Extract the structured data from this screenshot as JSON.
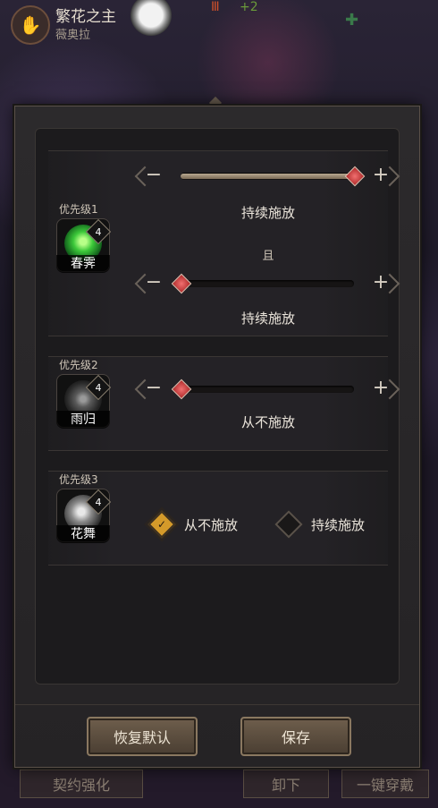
{
  "hud": {
    "title": "繁花之主",
    "subtitle": "薇奥拉",
    "counter": "+2"
  },
  "bottom_bar": {
    "contract": "契约强化",
    "unequip": "卸下",
    "equip_all": "一键穿戴"
  },
  "dialog": {
    "rows": [
      {
        "priority": "优先级1",
        "skill_name": "春霁",
        "level": "4",
        "icon": "green-flame-icon",
        "slider1_value": 1.0,
        "condition1": "持续施放",
        "joiner": "且",
        "slider2_value": 0.0,
        "condition2": "持续施放"
      },
      {
        "priority": "优先级2",
        "skill_name": "雨归",
        "level": "4",
        "icon": "dark-vortex-icon",
        "slider_value": 0.0,
        "condition": "从不施放"
      },
      {
        "priority": "优先级3",
        "skill_name": "花舞",
        "level": "4",
        "icon": "flower-dance-icon",
        "option_never": "从不施放",
        "option_always": "持续施放",
        "selected": "从不施放"
      }
    ],
    "buttons": {
      "reset": "恢复默认",
      "save": "保存"
    }
  }
}
